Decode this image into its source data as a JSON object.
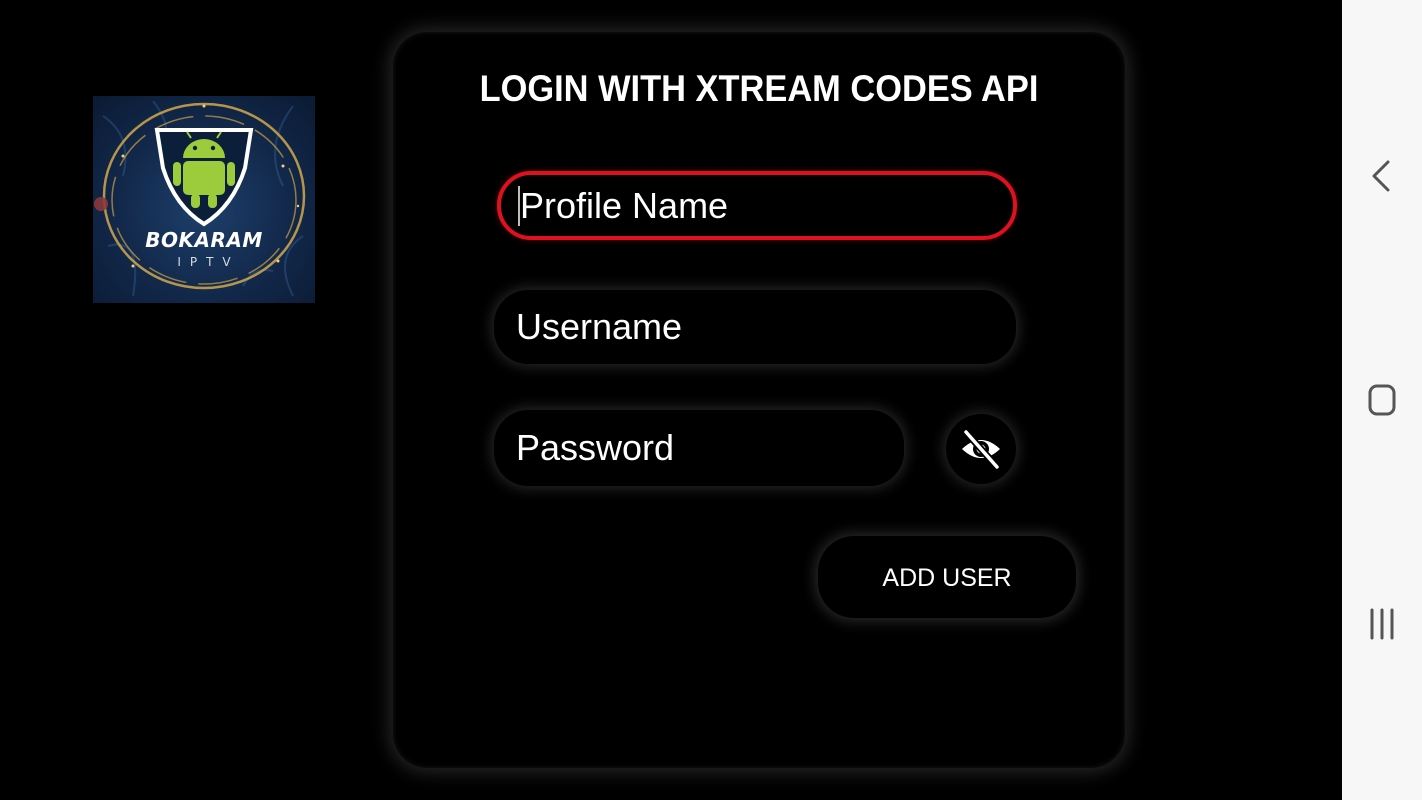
{
  "app": {
    "logo": {
      "brand": "BOKARAM",
      "sub": "IPTV"
    }
  },
  "login": {
    "title": "LOGIN WITH XTREAM CODES API",
    "profile_placeholder": "Profile Name",
    "username_placeholder": "Username",
    "password_placeholder": "Password",
    "add_user_label": "ADD USER",
    "password_toggle_icon": "eye-off-icon"
  },
  "navbar": {
    "items": [
      {
        "icon": "back-icon"
      },
      {
        "icon": "home-icon"
      },
      {
        "icon": "recents-icon"
      }
    ]
  },
  "colors": {
    "background": "#000000",
    "focus_border": "#e0101e",
    "text": "#ffffff",
    "navbar_bg": "#f7f7f7"
  }
}
